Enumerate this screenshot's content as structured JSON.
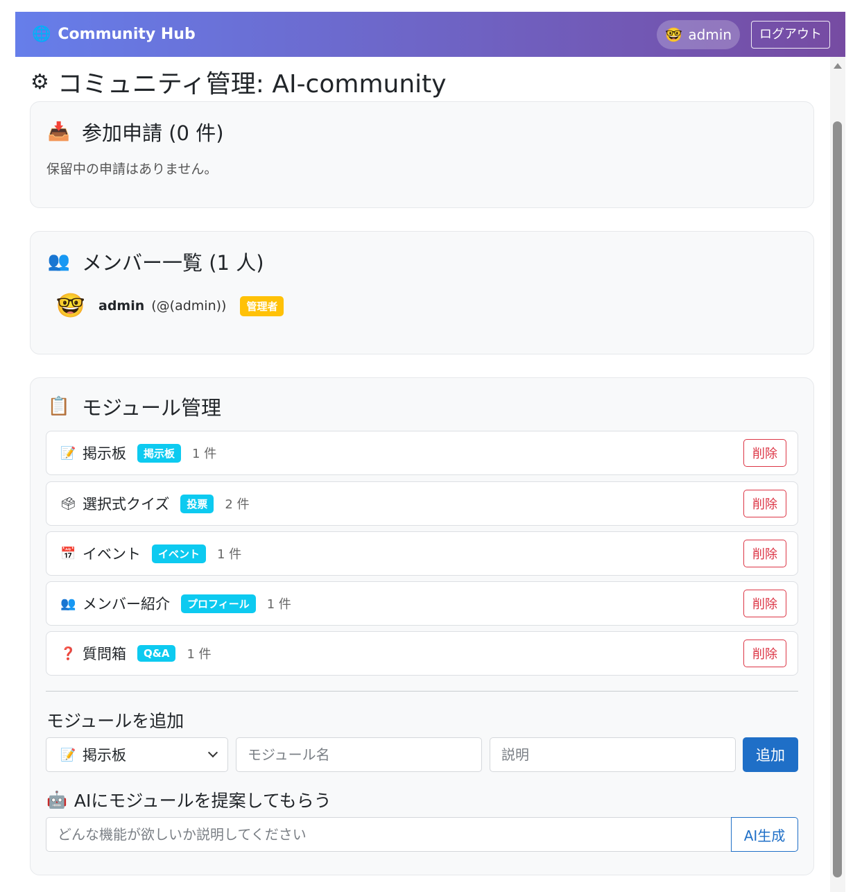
{
  "navbar": {
    "brand": "Community Hub",
    "brand_icon": "globe-icon",
    "user_name": "admin",
    "logout_label": "ログアウト"
  },
  "page": {
    "title": "コミュニティ管理: AI-community"
  },
  "requests": {
    "title": "参加申請 (0 件)",
    "empty_text": "保留中の申請はありません。"
  },
  "members": {
    "title": "メンバー一覧 (1 人)",
    "items": [
      {
        "name": "admin",
        "handle": "(@(admin))",
        "role": "管理者"
      }
    ]
  },
  "modules": {
    "title": "モジュール管理",
    "delete_label": "削除",
    "items": [
      {
        "icon": "memo-icon",
        "name": "掲示板",
        "type": "掲示板",
        "count": "1 件"
      },
      {
        "icon": "ballot-box-icon",
        "name": "選択式クイズ",
        "type": "投票",
        "count": "2 件"
      },
      {
        "icon": "calendar-icon",
        "name": "イベント",
        "type": "イベント",
        "count": "1 件"
      },
      {
        "icon": "people-icon",
        "name": "メンバー紹介",
        "type": "プロフィール",
        "count": "1 件"
      },
      {
        "icon": "question-icon",
        "name": "質問箱",
        "type": "Q&A",
        "count": "1 件"
      }
    ],
    "add": {
      "title": "モジュールを追加",
      "selected_type": "掲示板",
      "name_placeholder": "モジュール名",
      "desc_placeholder": "説明",
      "add_label": "追加"
    },
    "ai": {
      "title": "AIにモジュールを提案してもらう",
      "placeholder": "どんな機能が欲しいか説明してください",
      "button_label": "AI生成"
    }
  },
  "colors": {
    "nav_gradient_start": "#667eea",
    "nav_gradient_end": "#764ba2",
    "badge_warning": "#ffc107",
    "badge_info": "#0dcaf0",
    "danger": "#dc3545",
    "primary": "#1f6fc7"
  }
}
